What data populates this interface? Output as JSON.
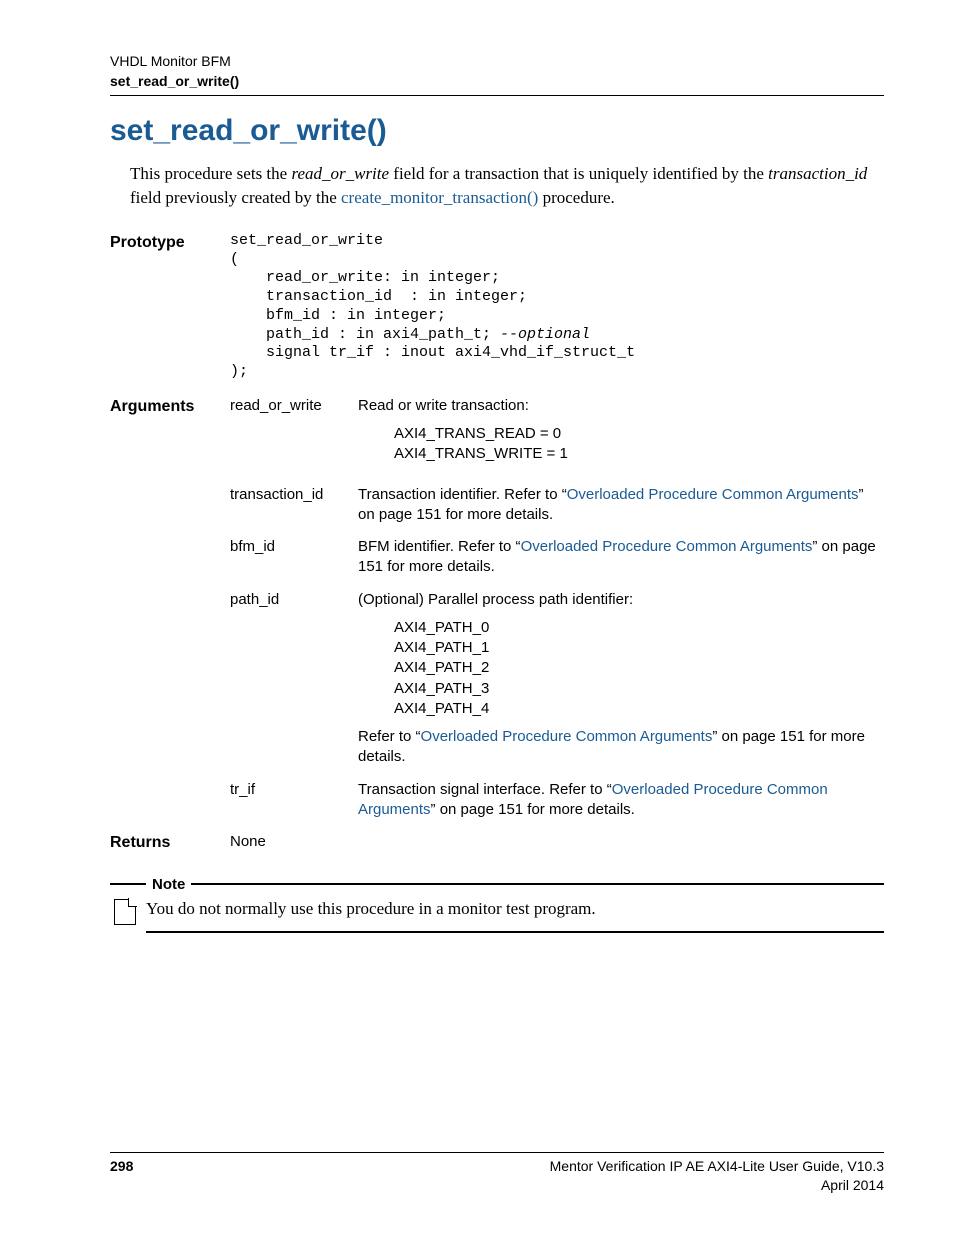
{
  "header": {
    "line1": "VHDL Monitor BFM",
    "line2": "set_read_or_write()"
  },
  "title": "set_read_or_write()",
  "intro": {
    "pre": "This procedure sets the ",
    "italic1": "read_or_write",
    "mid1": " field for a transaction that is uniquely identified by the ",
    "italic2": "transaction_id",
    "mid2": " field previously created by the ",
    "link": "create_monitor_transaction()",
    "post": " procedure."
  },
  "sections": {
    "prototype_label": "Prototype",
    "prototype_code": "set_read_or_write\n(\n    read_or_write: in integer;\n    transaction_id  : in integer;\n    bfm_id : in integer;\n    path_id : in axi4_path_t; --optional\n    signal tr_if : inout axi4_vhd_if_struct_t\n);",
    "prototype_optional": "--optional",
    "arguments_label": "Arguments",
    "args": [
      {
        "name": "read_or_write",
        "desc_lines": [
          "Read or write transaction:"
        ],
        "sub_lines": [
          "AXI4_TRANS_READ = 0",
          "AXI4_TRANS_WRITE = 1"
        ]
      },
      {
        "name": "transaction_id",
        "desc_pre": "Transaction identifier. Refer to “",
        "desc_link": "Overloaded Procedure Common Arguments",
        "desc_post": "” on page 151 for more details."
      },
      {
        "name": "bfm_id",
        "desc_pre": "BFM identifier. Refer to “",
        "desc_link": "Overloaded Procedure Common Arguments",
        "desc_post": "” on page 151 for more details."
      },
      {
        "name": "path_id",
        "desc_lines": [
          "(Optional) Parallel process path identifier:"
        ],
        "sub_lines": [
          "AXI4_PATH_0",
          "AXI4_PATH_1",
          "AXI4_PATH_2",
          "AXI4_PATH_3",
          "AXI4_PATH_4"
        ],
        "tail_pre": "Refer to “",
        "tail_link": "Overloaded Procedure Common Arguments",
        "tail_post": "” on page 151 for more details."
      },
      {
        "name": "tr_if",
        "desc_pre": "Transaction signal interface. Refer to “",
        "desc_link": "Overloaded Procedure Common Arguments",
        "desc_post": "” on page 151 for more details."
      }
    ],
    "returns_label": "Returns",
    "returns_value": "None"
  },
  "note": {
    "label": "Note",
    "text": "You do not normally use this procedure in a monitor test program."
  },
  "footer": {
    "page": "298",
    "guide": "Mentor Verification IP AE AXI4-Lite User Guide, V10.3",
    "date": "April 2014"
  }
}
